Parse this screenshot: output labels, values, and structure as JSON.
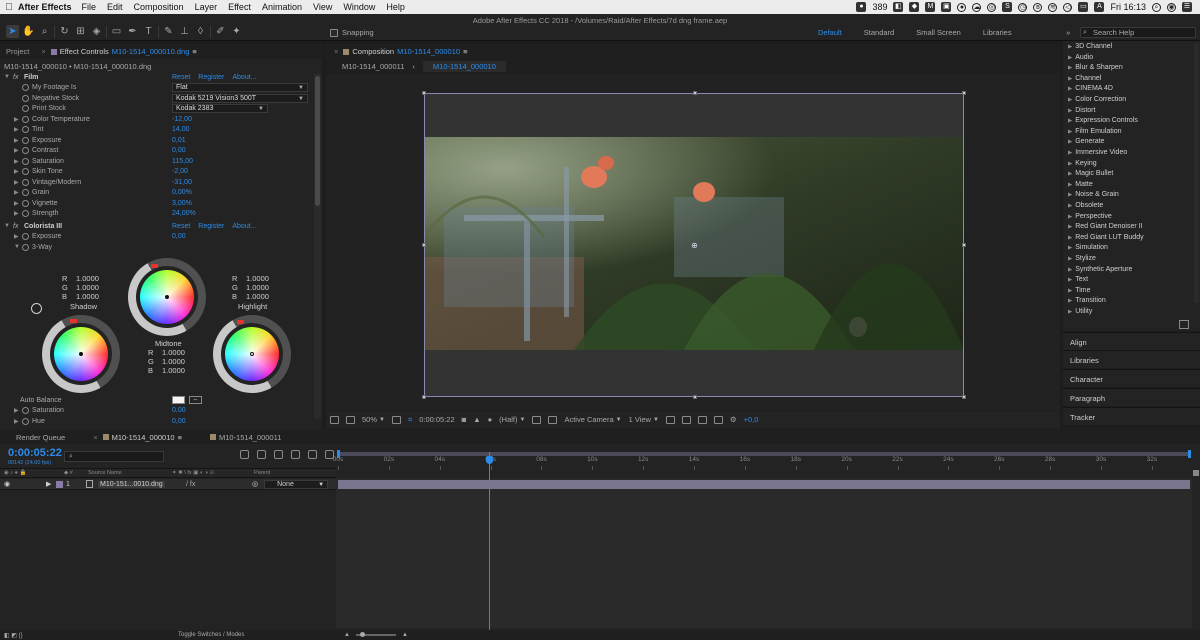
{
  "menubar": {
    "app_name": "After Effects",
    "items": [
      "File",
      "Edit",
      "Composition",
      "Layer",
      "Effect",
      "Animation",
      "View",
      "Window",
      "Help"
    ],
    "status_count": "389",
    "clock": "Fri 16:13"
  },
  "toolbar": {
    "window_title": "Adobe After Effects CC 2018 - /Volumes/Raid/After Effects/7d dng frame.aep",
    "snapping_label": "Snapping",
    "workspaces": [
      "Default",
      "Standard",
      "Small Screen",
      "Libraries"
    ],
    "active_workspace": "Default",
    "search_placeholder": "Search Help"
  },
  "effect_controls": {
    "tabs": {
      "project": "Project",
      "effect_controls_prefix": "Effect Controls",
      "effect_controls_item": "M10-1514_000010.dng"
    },
    "header": "M10-1514_000010 • M10-1514_000010.dng",
    "reset": "Reset",
    "register": "Register",
    "about": "About...",
    "film": {
      "name": "Film",
      "my_footage_label": "My Footage Is",
      "my_footage_value": "Flat",
      "negative_stock_label": "Negative Stock",
      "negative_stock_value": "Kodak 5219 Vision3 500T",
      "print_stock_label": "Print Stock",
      "print_stock_value": "Kodak 2383",
      "params": [
        {
          "label": "Color Temperature",
          "value": "-12,00"
        },
        {
          "label": "Tint",
          "value": "14,00"
        },
        {
          "label": "Exposure",
          "value": "0,01"
        },
        {
          "label": "Contrast",
          "value": "0,00"
        },
        {
          "label": "Saturation",
          "value": "115,00"
        },
        {
          "label": "Skin Tone",
          "value": "-2,00"
        },
        {
          "label": "Vintage/Modern",
          "value": "-31,00"
        },
        {
          "label": "Grain",
          "value": "0,00%"
        },
        {
          "label": "Vignette",
          "value": "3,00%"
        },
        {
          "label": "Strength",
          "value": "24,00%"
        }
      ]
    },
    "colorista": {
      "name": "Colorista III",
      "exposure_label": "Exposure",
      "exposure_value": "0,00",
      "three_way_label": "3-Way",
      "shadow": {
        "label": "Shadow",
        "r": "1.0000",
        "g": "1.0000",
        "b": "1.0000"
      },
      "midtone": {
        "label": "Midtone",
        "r": "1.0000",
        "g": "1.0000",
        "b": "1.0000"
      },
      "highlight": {
        "label": "Highlight",
        "r": "1.0000",
        "g": "1.0000",
        "b": "1.0000"
      },
      "r_key": "R",
      "g_key": "G",
      "b_key": "B",
      "auto_balance_label": "Auto Balance",
      "saturation_label": "Saturation",
      "saturation_value": "0,00",
      "hue_label": "Hue",
      "hue_value": "0,00"
    }
  },
  "composition": {
    "tab_prefix": "Composition",
    "tab_name": "M10-1514_000010",
    "sub_tabs": [
      "M10-1514_000011",
      "M10-1514_000010"
    ],
    "footer": {
      "zoom": "50%",
      "timecode": "0:00:05:22",
      "resolution": "(Half)",
      "camera": "Active Camera",
      "views": "1 View",
      "exposure": "+0,0"
    }
  },
  "effects_list": [
    "3D Channel",
    "Audio",
    "Blur & Sharpen",
    "Channel",
    "CINEMA 4D",
    "Color Correction",
    "Distort",
    "Expression Controls",
    "Film Emulation",
    "Generate",
    "Immersive Video",
    "Keying",
    "Magic Bullet",
    "Matte",
    "Noise & Grain",
    "Obsolete",
    "Perspective",
    "Red Giant Denoiser II",
    "Red Giant LUT Buddy",
    "Simulation",
    "Stylize",
    "Synthetic Aperture",
    "Text",
    "Time",
    "Transition",
    "Utility"
  ],
  "side_panels": [
    "Align",
    "Libraries",
    "Character",
    "Paragraph",
    "Tracker"
  ],
  "timeline": {
    "tabs": [
      "Render Queue",
      "M10-1514_000010",
      "M10-1514_000011"
    ],
    "current_time": "0:00:05:22",
    "fps_note": "00142 (24.00 fps)",
    "search_placeholder": "",
    "col_source_name": "Source Name",
    "col_parent": "Parent",
    "layer": {
      "num": "1",
      "name": "M10-151...0010.dng",
      "parent": "None"
    },
    "ruler_labels": [
      "00s",
      "02s",
      "04s",
      "06s",
      "08s",
      "10s",
      "12s",
      "14s",
      "16s",
      "18s",
      "20s",
      "22s",
      "24s",
      "26s",
      "28s",
      "30s",
      "32s"
    ],
    "ruler_max_seconds": 33.5,
    "playhead_seconds": 5.92,
    "toggle_label": "Toggle Switches / Modes"
  }
}
